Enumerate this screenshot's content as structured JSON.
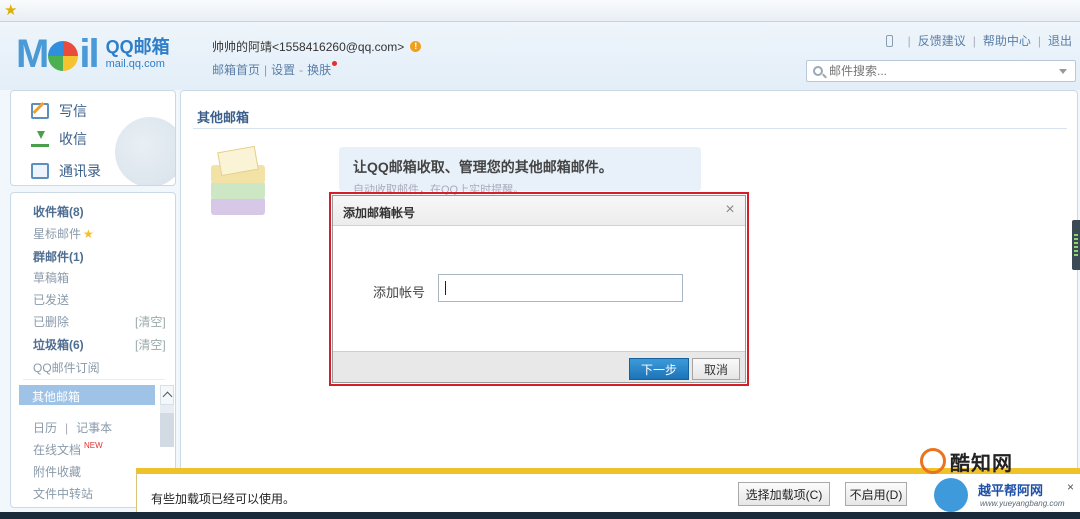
{
  "header": {
    "logo_word": "Mail",
    "brand_name": "QQ邮箱",
    "brand_domain": "mail.qq.com",
    "user": "帅帅的阿靖<1558416260@qq.com>",
    "links": [
      "邮箱首页",
      "设置",
      "换肤"
    ],
    "top_links": [
      "反馈建议",
      "帮助中心",
      "退出"
    ],
    "search_placeholder": "邮件搜索..."
  },
  "sidebar": {
    "commands": [
      {
        "label": "写信",
        "icon": "compose-icon"
      },
      {
        "label": "收信",
        "icon": "inbox-download-icon"
      },
      {
        "label": "通讯录",
        "icon": "contacts-icon"
      }
    ],
    "folders": {
      "inbox": "收件箱(8)",
      "starred": "星标邮件",
      "group": "群邮件(1)",
      "drafts": "草稿箱",
      "sent": "已发送",
      "deleted": "已删除",
      "spam": "垃圾箱(6)",
      "subscriptions": "QQ邮件订阅",
      "other": "其他邮箱",
      "calendar": "日历",
      "notes": "记事本",
      "docs": "在线文档",
      "docs_badge": "NEW",
      "attachments": "附件收藏",
      "transfer": "文件中转站"
    },
    "clear_label": "[清空]"
  },
  "main": {
    "title": "其他邮箱",
    "intro_heading": "让QQ邮箱收取、管理您的其他邮箱邮件。",
    "intro_sub": "自动收取邮件，在QQ上实时提醒。"
  },
  "dialog": {
    "title": "添加邮箱帐号",
    "field_label": "添加帐号",
    "field_value": "",
    "next_label": "下一步",
    "cancel_label": "取消"
  },
  "notification": {
    "text": "有些加载项已经可以使用。",
    "choose_label": "选择加载项(C)",
    "disable_label": "不启用(D)"
  },
  "watermarks": {
    "site1": "酷知网",
    "site2": "越平帮阿网",
    "site2_url": "www.yueyangbang.com"
  }
}
